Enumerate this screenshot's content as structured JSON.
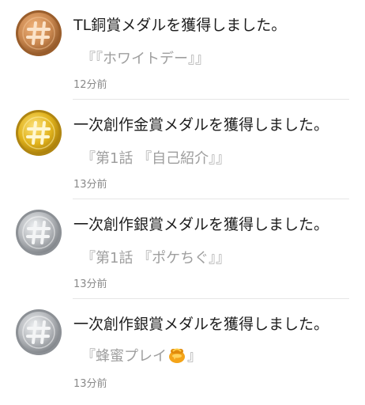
{
  "notifications": [
    {
      "medal": "bronze",
      "medal_icon": "bronze-medal-hash-icon",
      "title": "TL銅賞メダルを獲得しました。",
      "subtitle": "『『ホワイトデー』』",
      "time": "12分前"
    },
    {
      "medal": "gold",
      "medal_icon": "gold-medal-hash-icon",
      "title": "一次創作金賞メダルを獲得しました。",
      "subtitle": "『第1話 『自己紹介』』",
      "time": "13分前"
    },
    {
      "medal": "silver",
      "medal_icon": "silver-medal-hash-icon",
      "title": "一次創作銀賞メダルを獲得しました。",
      "subtitle": "『第1話 『ポケちぐ』』",
      "time": "13分前"
    },
    {
      "medal": "silver",
      "medal_icon": "silver-medal-hash-icon",
      "title": "一次創作銀賞メダルを獲得しました。",
      "subtitle_before": "『蜂蜜プレイ",
      "subtitle_emoji": "honey-pot-icon",
      "subtitle_after": "』",
      "time": "13分前"
    }
  ],
  "colors": {
    "bronze": "#c8864e",
    "gold": "#e0b21c",
    "silver": "#b3b6ba",
    "title_text": "#1e1e1e",
    "subtitle_text": "#9e9e9e",
    "time_text": "#8a8a8a"
  }
}
